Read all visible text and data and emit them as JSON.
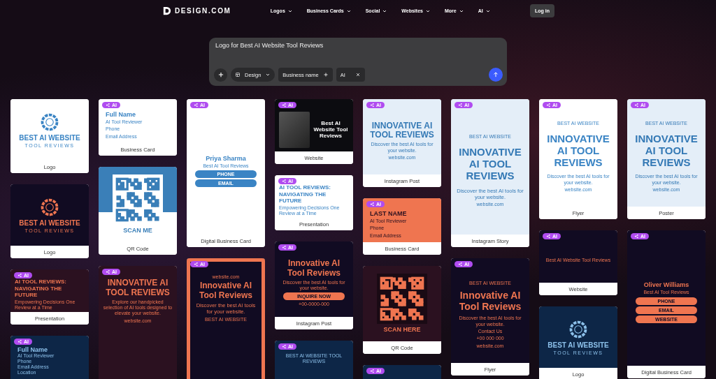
{
  "header": {
    "logo": "DESIGN.COM",
    "nav": [
      {
        "label": "Logos"
      },
      {
        "label": "Business Cards"
      },
      {
        "label": "Social"
      },
      {
        "label": "Websites"
      },
      {
        "label": "More"
      },
      {
        "label": "AI"
      }
    ],
    "login": "Log in"
  },
  "prompt": {
    "value": "Logo for Best AI Website Tool Reviews",
    "chips": [
      {
        "kind": "dropdown",
        "label": "Design"
      },
      {
        "kind": "add",
        "label": "Business name"
      },
      {
        "kind": "remove",
        "label": "AI"
      }
    ]
  },
  "columns": [
    {
      "cards": [
        {
          "kind": "logo-light",
          "caption": "Logo",
          "lines": [
            {
              "kind": "title",
              "text": "BEST AI WEBSITE"
            },
            {
              "kind": "spaced",
              "text": "TOOL REVIEWS"
            }
          ]
        },
        {
          "kind": "logo-dark",
          "caption": "Logo",
          "lines": [
            {
              "kind": "title",
              "text": "BEST AI WEBSITE"
            },
            {
              "kind": "spaced",
              "text": "TOOL REVIEWS"
            }
          ]
        },
        {
          "kind": "presentation-brown",
          "badge": "AI",
          "caption": "Presentation",
          "lines": [
            {
              "kind": "title",
              "text": "AI TOOL REVIEWS: NAVIGATING THE FUTURE"
            },
            {
              "kind": "small",
              "text": "Empowering Decisions One Review at a Time"
            }
          ]
        },
        {
          "kind": "namecard-navy",
          "badge": "AI",
          "lines": [
            {
              "kind": "title",
              "text": "Full Name"
            },
            {
              "kind": "small",
              "text": "AI Tool Reviewer"
            },
            {
              "kind": "small",
              "text": "Phone"
            },
            {
              "kind": "small",
              "text": "Email Address"
            },
            {
              "kind": "small",
              "text": "Location"
            }
          ]
        }
      ]
    },
    {
      "cards": [
        {
          "kind": "card-light",
          "badge": "AI",
          "caption": "Business Card",
          "lines": [
            {
              "kind": "title",
              "text": "Full Name"
            },
            {
              "kind": "small",
              "text": "AI Tool Reviewer"
            },
            {
              "kind": "small",
              "text": "Phone"
            },
            {
              "kind": "small",
              "text": "Email Address"
            }
          ]
        },
        {
          "kind": "qr-blue",
          "caption": "QR Code",
          "lines": [
            {
              "kind": "title",
              "text": "SCAN ME"
            }
          ]
        },
        {
          "kind": "cut-brown",
          "badge": "AI",
          "lines": [
            {
              "kind": "title",
              "text": "INNOVATIVE AI TOOL REVIEWS"
            },
            {
              "kind": "small",
              "text": "Explore our handpicked selection of AI tools designed to elevate your website."
            },
            {
              "kind": "small",
              "text": "website.com"
            }
          ]
        }
      ]
    },
    {
      "cards": [
        {
          "kind": "dbc-light",
          "badge": "AI",
          "caption": "Digital Business Card",
          "lines": [
            {
              "kind": "title",
              "text": "Priya Sharma"
            },
            {
              "kind": "small",
              "text": "Best AI Tool Reviews"
            },
            {
              "kind": "pill",
              "text": "PHONE"
            },
            {
              "kind": "pill",
              "text": "EMAIL"
            }
          ]
        },
        {
          "kind": "cut-frame",
          "badge": "AI",
          "lines": [
            {
              "kind": "small",
              "text": "website.com"
            },
            {
              "kind": "title",
              "text": "Innovative AI Tool Reviews"
            },
            {
              "kind": "sub",
              "text": "Discover the best AI tools for your website."
            },
            {
              "kind": "small",
              "text": "BEST AI WEBSITE"
            }
          ]
        }
      ]
    },
    {
      "cards": [
        {
          "kind": "website-photo",
          "badge": "AI",
          "caption": "Website",
          "lines": [
            {
              "kind": "title",
              "text": "Best AI Website Tool Reviews"
            }
          ]
        },
        {
          "kind": "presentation-light",
          "badge": "AI",
          "caption": "Presentation",
          "lines": [
            {
              "kind": "title",
              "text": "AI TOOL REVIEWS: NAVIGATING THE FUTURE"
            },
            {
              "kind": "small",
              "text": "Empowering Decisions One Review at a Time"
            }
          ]
        },
        {
          "kind": "post-dark",
          "badge": "AI",
          "caption": "Instagram Post",
          "lines": [
            {
              "kind": "title",
              "text": "Innovative AI Tool Reviews"
            },
            {
              "kind": "small",
              "text": "Discover the best AI tools for your website."
            },
            {
              "kind": "pill",
              "text": "INQUIRE NOW"
            },
            {
              "kind": "small",
              "text": "+00-0000-000"
            }
          ]
        },
        {
          "kind": "cut-navy",
          "badge": "AI",
          "lines": [
            {
              "kind": "small",
              "text": "BEST AI WEBSITE TOOL REVIEWS"
            }
          ]
        }
      ]
    },
    {
      "cards": [
        {
          "kind": "post-pale",
          "badge": "AI",
          "caption": "Instagram Post",
          "lines": [
            {
              "kind": "title",
              "text": "INNOVATIVE AI TOOL REVIEWS"
            },
            {
              "kind": "small",
              "text": "Discover the best AI tools for your website."
            },
            {
              "kind": "small",
              "text": "website.com"
            }
          ]
        },
        {
          "kind": "card-orange",
          "badge": "AI",
          "caption": "Business Card",
          "lines": [
            {
              "kind": "title",
              "text": "LAST NAME"
            },
            {
              "kind": "small",
              "text": "AI Tool Reviewer"
            },
            {
              "kind": "small",
              "text": "Phone"
            },
            {
              "kind": "small",
              "text": "Email Address"
            }
          ]
        },
        {
          "kind": "qr-brown",
          "caption": "QR Code",
          "lines": [
            {
              "kind": "title",
              "text": "SCAN HERE"
            }
          ]
        },
        {
          "kind": "cut-navy",
          "badge": "AI"
        }
      ]
    },
    {
      "cards": [
        {
          "kind": "story-pale",
          "badge": "AI",
          "caption": "Instagram Story",
          "lines": [
            {
              "kind": "small",
              "text": "BEST AI WEBSITE"
            },
            {
              "kind": "title",
              "text": "INNOVATIVE AI TOOL REVIEWS"
            },
            {
              "kind": "sub",
              "text": "Discover the best AI tools for your website."
            },
            {
              "kind": "small",
              "text": "website.com"
            }
          ]
        },
        {
          "kind": "tall-dark",
          "badge": "AI",
          "caption": "Flyer",
          "lines": [
            {
              "kind": "small",
              "text": "BEST AI WEBSITE"
            },
            {
              "kind": "title",
              "text": "Innovative AI Tool Reviews"
            },
            {
              "kind": "small",
              "text": "Discover the best AI tools for your website."
            },
            {
              "kind": "small",
              "text": "Contact Us"
            },
            {
              "kind": "small",
              "text": "+00 000 000"
            },
            {
              "kind": "small",
              "text": "website.com"
            }
          ]
        }
      ]
    },
    {
      "cards": [
        {
          "kind": "flyer-light",
          "badge": "AI",
          "caption": "Flyer",
          "lines": [
            {
              "kind": "small",
              "text": "BEST AI WEBSITE"
            },
            {
              "kind": "title",
              "text": "INNOVATIVE AI TOOL REVIEWS"
            },
            {
              "kind": "small",
              "text": "Discover the best AI tools for your website."
            },
            {
              "kind": "small",
              "text": "website.com"
            }
          ]
        },
        {
          "kind": "website-dark",
          "badge": "AI",
          "caption": "Website",
          "lines": [
            {
              "kind": "small",
              "text": "Best AI Website Tool Reviews"
            }
          ]
        },
        {
          "kind": "logo-navy",
          "caption": "Logo",
          "lines": [
            {
              "kind": "title",
              "text": "BEST AI WEBSITE"
            },
            {
              "kind": "spaced",
              "text": "TOOL REVIEWS"
            }
          ]
        }
      ]
    },
    {
      "cards": [
        {
          "kind": "flyer-pale",
          "badge": "AI",
          "caption": "Poster",
          "lines": [
            {
              "kind": "small",
              "text": "BEST AI WEBSITE"
            },
            {
              "kind": "title",
              "text": "INNOVATIVE AI TOOL REVIEWS"
            },
            {
              "kind": "small",
              "text": "Discover the best AI tools for your website."
            },
            {
              "kind": "small",
              "text": "website.com"
            }
          ]
        },
        {
          "kind": "dbc-dark",
          "badge": "AI",
          "caption": "Digital Business Card",
          "lines": [
            {
              "kind": "title",
              "text": "Oliver Williams"
            },
            {
              "kind": "small",
              "text": "Best AI Tool Reviews"
            },
            {
              "kind": "pill",
              "text": "PHONE"
            },
            {
              "kind": "pill",
              "text": "EMAIL"
            },
            {
              "kind": "pill",
              "text": "WEBSITE"
            }
          ]
        }
      ]
    }
  ]
}
